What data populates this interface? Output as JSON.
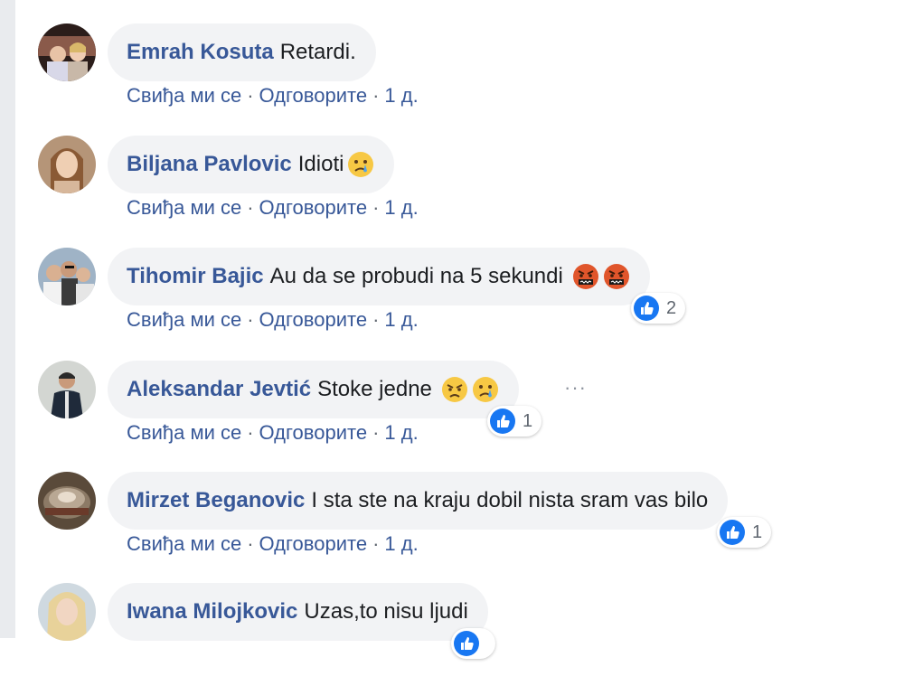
{
  "actions": {
    "like": "Свиђа ми се",
    "reply": "Одговорите",
    "time": "1 д.",
    "separator": "·"
  },
  "comments": [
    {
      "author": "Emrah Kosuta",
      "text": "Retardi.",
      "emojis": []
    },
    {
      "author": "Biljana Pavlovic",
      "text": "Idioti",
      "emojis": [
        "crying-face"
      ]
    },
    {
      "author": "Tihomir Bajic",
      "text": "Au da se probudi na 5 sekundi",
      "emojis": [
        "cursing-face",
        "cursing-face"
      ],
      "reactions": {
        "type": "like",
        "count": "2"
      }
    },
    {
      "author": "Aleksandar Jevtić",
      "text": "Stoke jedne",
      "emojis": [
        "angry-face",
        "crying-face"
      ],
      "reactions": {
        "type": "like",
        "count": "1"
      },
      "has_more_menu": true,
      "more_icon": "···"
    },
    {
      "author": "Mirzet Beganovic",
      "text": "I sta ste na kraju dobil nista sram vas bilo",
      "emojis": [],
      "reactions": {
        "type": "like",
        "count": "1"
      }
    },
    {
      "author": "Iwana Milojkovic",
      "text": "Uzas,to nisu ljudi",
      "emojis": [],
      "reactions": {
        "type": "like"
      }
    }
  ],
  "colors": {
    "author": "#385898",
    "bubble": "#f2f3f5",
    "like_blue": "#1877f2",
    "meta": "#606770",
    "rail": "#e9ebee"
  }
}
